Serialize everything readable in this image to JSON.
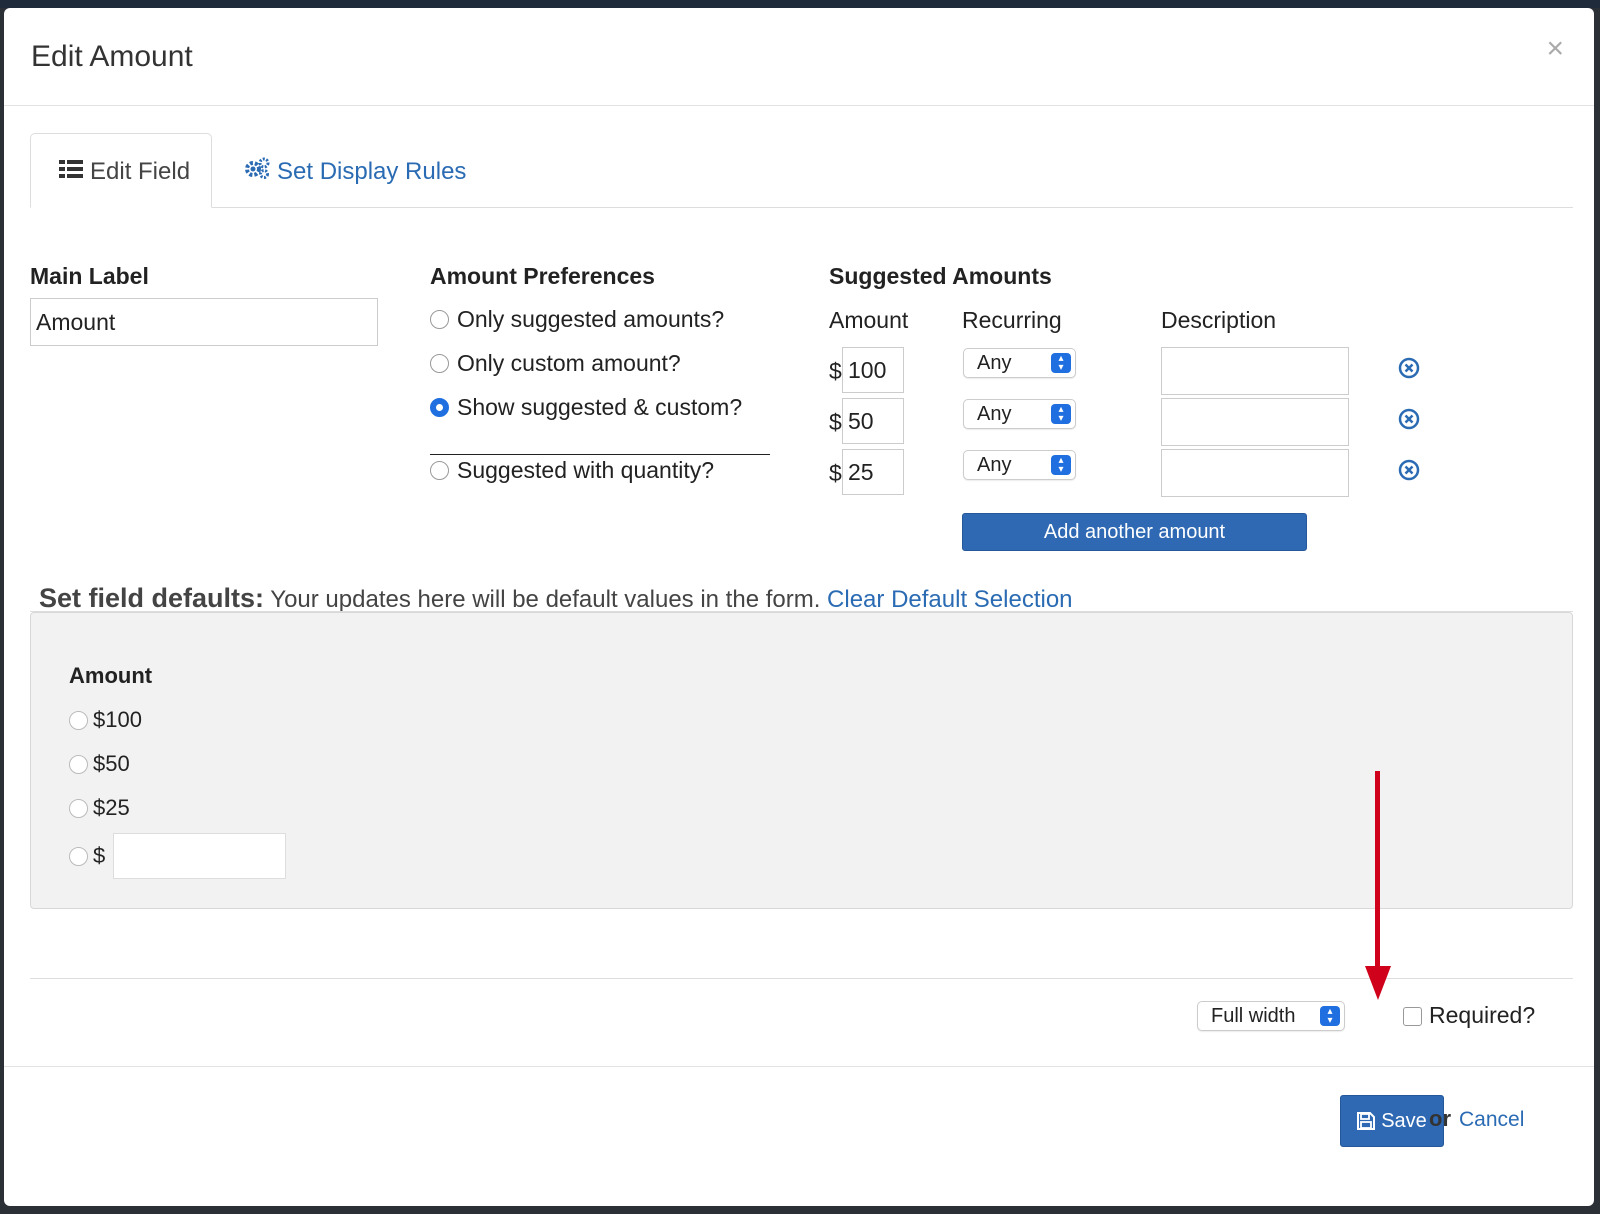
{
  "modal": {
    "title": "Edit Amount",
    "close_label": "×"
  },
  "tabs": [
    {
      "label": "Edit Field",
      "icon": "list-icon",
      "active": true
    },
    {
      "label": "Set Display Rules",
      "icon": "gears-icon",
      "active": false
    }
  ],
  "main_label": {
    "heading": "Main Label",
    "value": "Amount"
  },
  "amount_preferences": {
    "heading": "Amount Preferences",
    "options": [
      {
        "label": "Only suggested amounts?",
        "checked": false
      },
      {
        "label": "Only custom amount?",
        "checked": false
      },
      {
        "label": "Show suggested & custom?",
        "checked": true
      },
      {
        "label": "Suggested with quantity?",
        "checked": false
      }
    ]
  },
  "suggested_amounts": {
    "heading": "Suggested Amounts",
    "columns": {
      "amount": "Amount",
      "recurring": "Recurring",
      "description": "Description"
    },
    "currency_symbol": "$",
    "rows": [
      {
        "amount": "100",
        "recurring": "Any",
        "description": ""
      },
      {
        "amount": "50",
        "recurring": "Any",
        "description": ""
      },
      {
        "amount": "25",
        "recurring": "Any",
        "description": ""
      }
    ],
    "add_button": "Add another amount"
  },
  "defaults": {
    "title": "Set field defaults:",
    "text": " Your updates here will be default values in the form. ",
    "clear_link": "Clear Default Selection",
    "panel": {
      "heading": "Amount",
      "options": [
        "$100",
        "$50",
        "$25"
      ],
      "custom_prefix": "$",
      "custom_value": ""
    }
  },
  "layout_options": {
    "width_select": "Full width",
    "required_label": "Required?",
    "required_checked": false
  },
  "footer": {
    "save_label": "Save",
    "or_label": "or",
    "cancel_label": "Cancel"
  },
  "colors": {
    "primary": "#2f69b3",
    "link": "#2a6bb3",
    "annotation_arrow": "#d0021b",
    "radio_selected": "#1f6fe0"
  }
}
